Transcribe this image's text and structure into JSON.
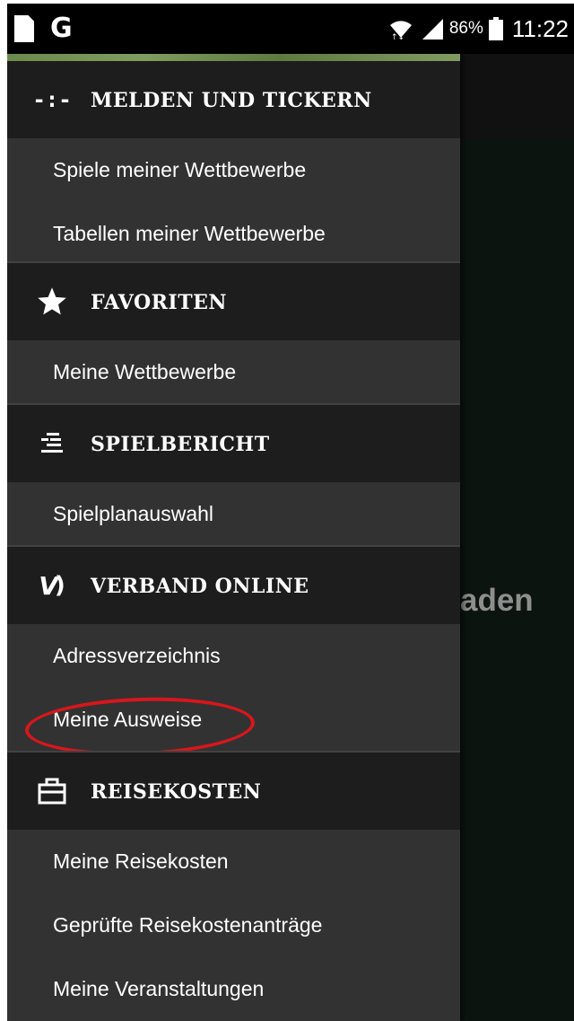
{
  "status_bar": {
    "carrier_icon": "google-g",
    "carrier_letter": "G",
    "battery_percent": "86%",
    "time": "11:22"
  },
  "background": {
    "partial_text": "aden"
  },
  "drawer": {
    "sections": [
      {
        "icon": "ticker-dash-icon",
        "icon_glyph": "-:-",
        "title": "MELDEN UND TICKERN",
        "items": [
          "Spiele meiner Wettbewerbe",
          "Tabellen meiner Wettbewerbe"
        ]
      },
      {
        "icon": "star-icon",
        "title": "FAVORITEN",
        "items": [
          "Meine Wettbewerbe"
        ]
      },
      {
        "icon": "match-report-icon",
        "title": "SPIELBERICHT",
        "items": [
          "Spielplanauswahl"
        ]
      },
      {
        "icon": "verband-logo-icon",
        "icon_glyph": "V",
        "title": "VERBAND ONLINE",
        "items": [
          "Adressverzeichnis",
          "Meine Ausweise"
        ]
      },
      {
        "icon": "briefcase-icon",
        "title": "REISEKOSTEN",
        "items": [
          "Meine Reisekosten",
          "Geprüfte Reisekostenanträge",
          "Meine Veranstaltungen"
        ]
      }
    ]
  },
  "colors": {
    "drawer_bg": "#323232",
    "section_header_bg": "#1d1d1d",
    "highlight": "#d9161c"
  }
}
